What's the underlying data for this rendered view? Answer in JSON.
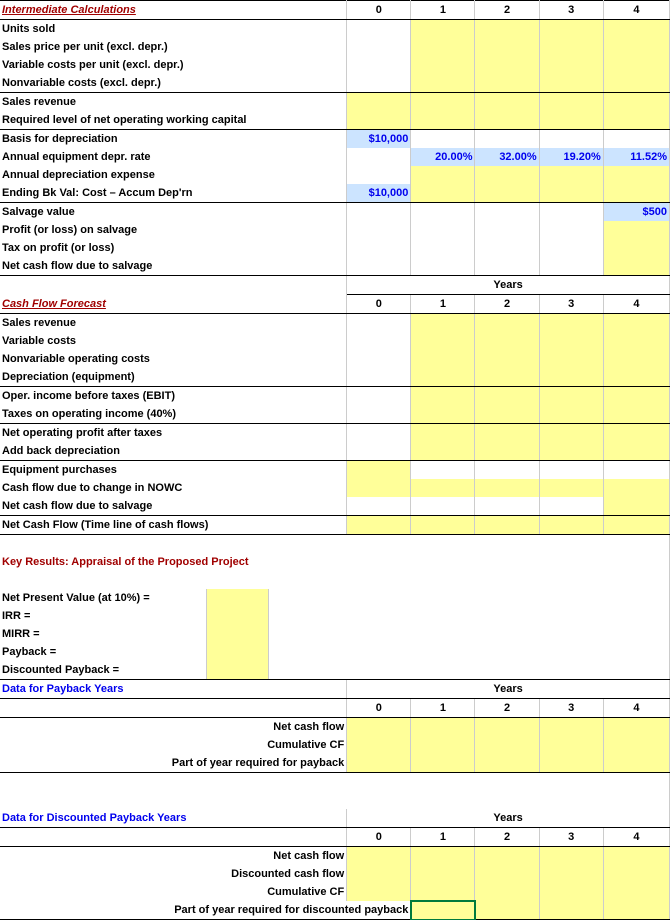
{
  "headers": {
    "y0": "0",
    "y1": "1",
    "y2": "2",
    "y3": "3",
    "y4": "4",
    "years": "Years"
  },
  "sec1": {
    "title": "Intermediate Calculations",
    "r1": "Units sold",
    "r2": "Sales price per unit (excl. depr.)",
    "r3": "Variable costs per unit (excl. depr.)",
    "r4": "Nonvariable costs (excl. depr.)",
    "r5": "Sales revenue",
    "r6": "Required level of net operating working capital",
    "r7": "Basis for depreciation",
    "r8": "Annual equipment depr. rate",
    "r9": "Annual depreciation expense",
    "r10": "Ending Bk Val: Cost – Accum Dep'rn",
    "r11": "Salvage value",
    "r12": "Profit (or loss) on salvage",
    "r13": "Tax on profit (or loss)",
    "r14": "Net cash flow due to salvage",
    "basis": "$10,000",
    "rate1": "20.00%",
    "rate2": "32.00%",
    "rate3": "19.20%",
    "rate4": "11.52%",
    "endbk": "$10,000",
    "salvage": "$500"
  },
  "sec2": {
    "title": "Cash Flow Forecast",
    "r1": "Sales revenue",
    "r2": "Variable costs",
    "r3": "Nonvariable operating costs",
    "r4": "Depreciation (equipment)",
    "r5": "Oper. income before taxes (EBIT)",
    "r6": "Taxes on operating income (40%)",
    "r7": "Net operating profit after taxes",
    "r8": "Add back depreciation",
    "r9": "Equipment purchases",
    "r10": "Cash flow due to change in NOWC",
    "r11": "Net cash flow due to salvage",
    "r12": "Net Cash Flow (Time line of cash flows)"
  },
  "sec3": {
    "title": "Key Results:  Appraisal of the Proposed Project",
    "r1": "Net Present Value (at 10%) =",
    "r2": "IRR =",
    "r3": "MIRR =",
    "r4": "Payback =",
    "r5": "Discounted Payback ="
  },
  "sec4": {
    "title": "Data for Payback    Years",
    "r1": "Net cash flow",
    "r2": "Cumulative CF",
    "r3": "Part of year required  for payback"
  },
  "sec5": {
    "title": "Data for Discounted Payback    Years",
    "r1": "Net cash flow",
    "r2": "Discounted cash flow",
    "r3": "Cumulative CF",
    "r4": "Part of year required for discounted payback"
  }
}
